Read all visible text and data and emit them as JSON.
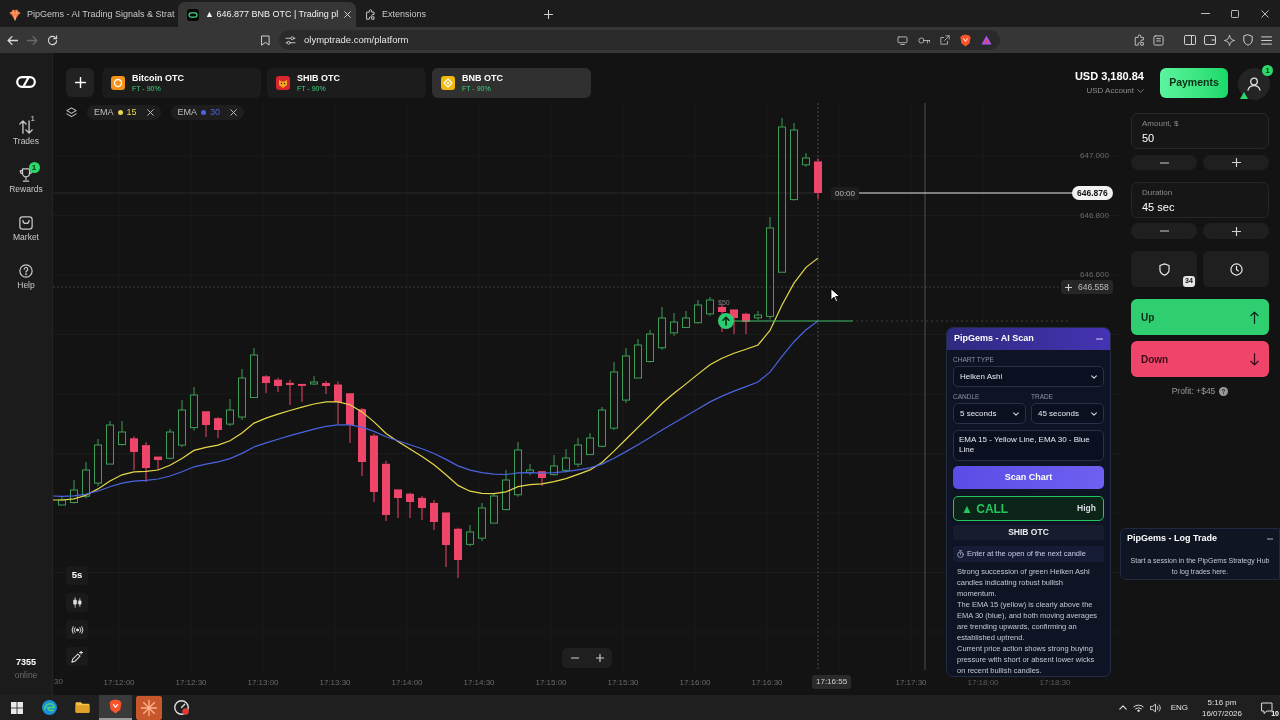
{
  "browser": {
    "tabs": [
      {
        "kind": "pipgems",
        "title": "PipGems - AI Trading Signals & Strat",
        "selected": false,
        "closable": false
      },
      {
        "kind": "olymp",
        "title": "▲ 646.877 BNB OTC | Trading pl",
        "selected": true,
        "closable": true
      },
      {
        "kind": "extensions",
        "title": "Extensions",
        "selected": false,
        "closable": false
      }
    ],
    "nav": {
      "back_disabled": false,
      "forward_disabled": true
    },
    "address": "olymptrade.com/platform"
  },
  "sidebar": {
    "items": [
      {
        "kind": "trades",
        "label": "Trades",
        "count": "1"
      },
      {
        "kind": "rewards",
        "label": "Rewards",
        "badge": "1"
      },
      {
        "kind": "market",
        "label": "Market"
      },
      {
        "kind": "help",
        "label": "Help"
      }
    ],
    "online": {
      "count": "7355",
      "label": "online"
    }
  },
  "header": {
    "asset_tabs": [
      {
        "kind": "bitcoin",
        "name": "Bitcoin OTC",
        "payout": "FT - 90%",
        "color": "#f7931a",
        "selected": false
      },
      {
        "kind": "shib",
        "name": "SHIB OTC",
        "payout": "FT - 90%",
        "color": "#d9262c",
        "selected": false
      },
      {
        "kind": "bnb",
        "name": "BNB OTC",
        "payout": "FT - 90%",
        "color": "#f0b90b",
        "selected": true
      }
    ],
    "balance": "USD 3,180.84",
    "account": "USD Account",
    "payments": "Payments",
    "profile_badge": "1"
  },
  "indicators": [
    {
      "name": "EMA",
      "period": "15",
      "color": "#e6d84a"
    },
    {
      "name": "EMA",
      "period": "30",
      "color": "#4a63e0"
    }
  ],
  "chart": {
    "price_ticks": [
      "647.000",
      "646.800",
      "646.600"
    ],
    "current_price": "646.876",
    "countdown": "00:00",
    "crosshair_price": "646.558",
    "trade": {
      "amount": "$50",
      "up": true
    },
    "time_ticks": [
      "30",
      "17:12:00",
      "17:12:30",
      "17:13:00",
      "17:13:30",
      "17:14:00",
      "17:14:30",
      "17:15:00",
      "17:15:30",
      "17:16:00",
      "17:16:30",
      "17:17:30",
      "17:18:00",
      "17:18:30"
    ],
    "crosshair_time": "17:16:55",
    "timeframe": "5s"
  },
  "trade_panel": {
    "amount": {
      "label": "Amount, $",
      "value": "50"
    },
    "duration": {
      "label": "Duration",
      "value": "45 sec"
    },
    "insurance_count": "34",
    "up": "Up",
    "down": "Down",
    "profit": "Profit: +$45"
  },
  "ai_scan": {
    "title": "PipGems - AI Scan",
    "chart_type": {
      "label": "CHART TYPE",
      "value": "Heiken Ashi"
    },
    "candle": {
      "label": "CANDLE",
      "value": "5 seconds"
    },
    "trade": {
      "label": "TRADE",
      "value": "45 seconds"
    },
    "notes": "EMA 15 - Yellow Line, EMA 30 - Blue Line",
    "scan_button": "Scan Chart",
    "signal": {
      "kind": "call",
      "direction": "▲ CALL",
      "confidence": "High"
    },
    "asset": "SHIB OTC",
    "entry": "Enter at the open of the next candle",
    "analysis": [
      "Strong succession of green Heiken Ashi candles indicating robust bullish momentum.",
      "The EMA 15 (yellow) is clearly above the EMA 30 (blue), and both moving averages are trending upwards, confirming an established uptrend.",
      "Current price action shows strong buying pressure with short or absent lower wicks on recent bullish candles."
    ]
  },
  "log_trade": {
    "title": "PipGems - Log Trade",
    "message": "Start a session in the PipGems Strategy Hub to log trades here."
  },
  "taskbar": {
    "apps": [
      {
        "kind": "start",
        "selected": false
      },
      {
        "kind": "edge",
        "selected": false
      },
      {
        "kind": "files",
        "selected": false
      },
      {
        "kind": "brave",
        "selected": true
      },
      {
        "kind": "burst",
        "selected": false
      },
      {
        "kind": "gauge",
        "selected": false
      }
    ],
    "language": "ENG",
    "time": "5:16 pm",
    "date": "16/07/2026",
    "notifications": "10"
  }
}
